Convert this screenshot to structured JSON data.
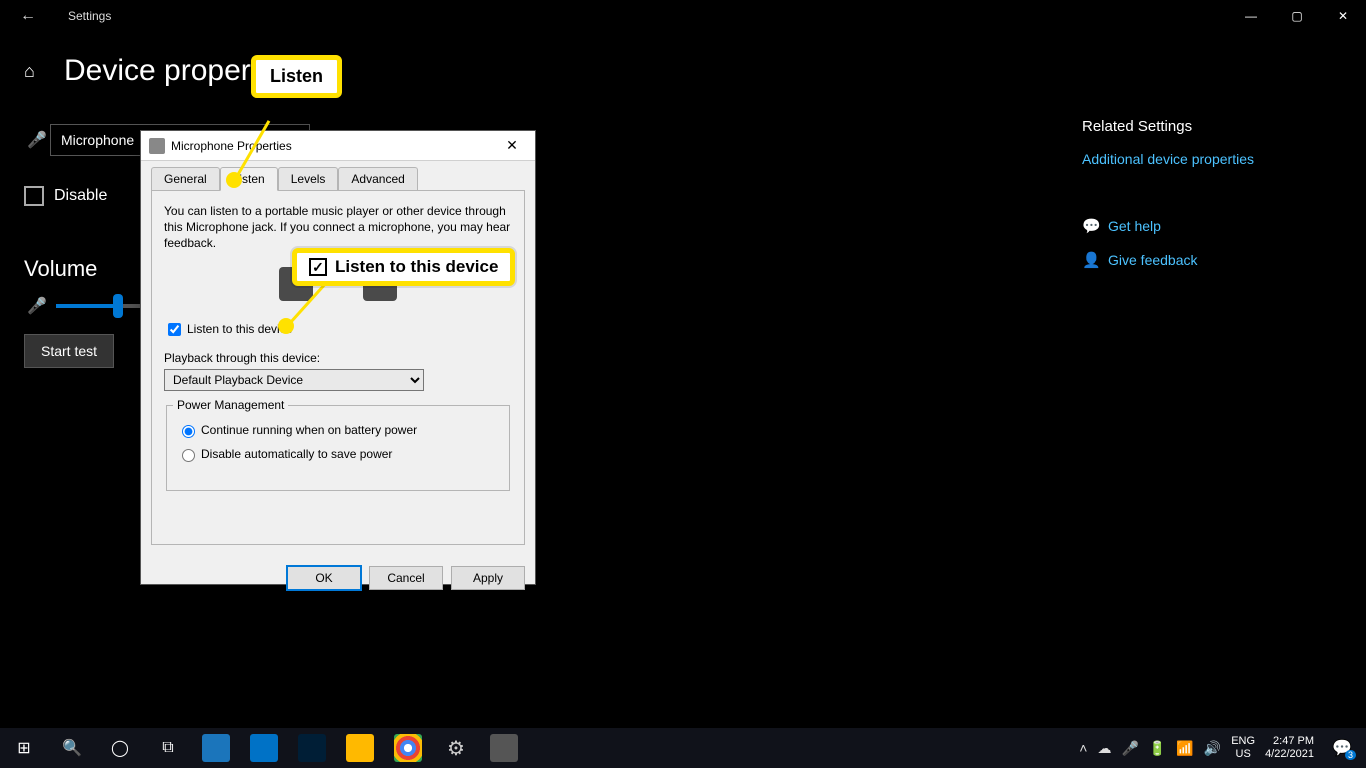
{
  "settings": {
    "app_title": "Settings",
    "page_title": "Device properties",
    "rename_value": "Microphone",
    "disable_label": "Disable",
    "volume_heading": "Volume",
    "start_test_label": "Start test",
    "caption": {
      "home_icon": "⌂",
      "back_icon": "←"
    }
  },
  "related": {
    "heading": "Related Settings",
    "link_additional": "Additional device properties",
    "help": "Get help",
    "feedback": "Give feedback"
  },
  "dialog": {
    "title": "Microphone Properties",
    "tabs": {
      "general": "General",
      "listen": "Listen",
      "levels": "Levels",
      "advanced": "Advanced"
    },
    "desc": "You can listen to a portable music player or other device through this Microphone jack.  If you connect a microphone, you may hear feedback.",
    "listen_checkbox": "Listen to this device",
    "playback_label": "Playback through this device:",
    "playback_value": "Default Playback Device",
    "power_group": "Power Management",
    "power_opt1": "Continue running when on battery power",
    "power_opt2": "Disable automatically to save power",
    "btn_ok": "OK",
    "btn_cancel": "Cancel",
    "btn_apply": "Apply"
  },
  "annot": {
    "listen": "Listen",
    "ltd": "Listen to this device"
  },
  "taskbar": {
    "lang1": "ENG",
    "lang2": "US",
    "time": "2:47 PM",
    "date": "4/22/2021",
    "notif_count": "3"
  }
}
